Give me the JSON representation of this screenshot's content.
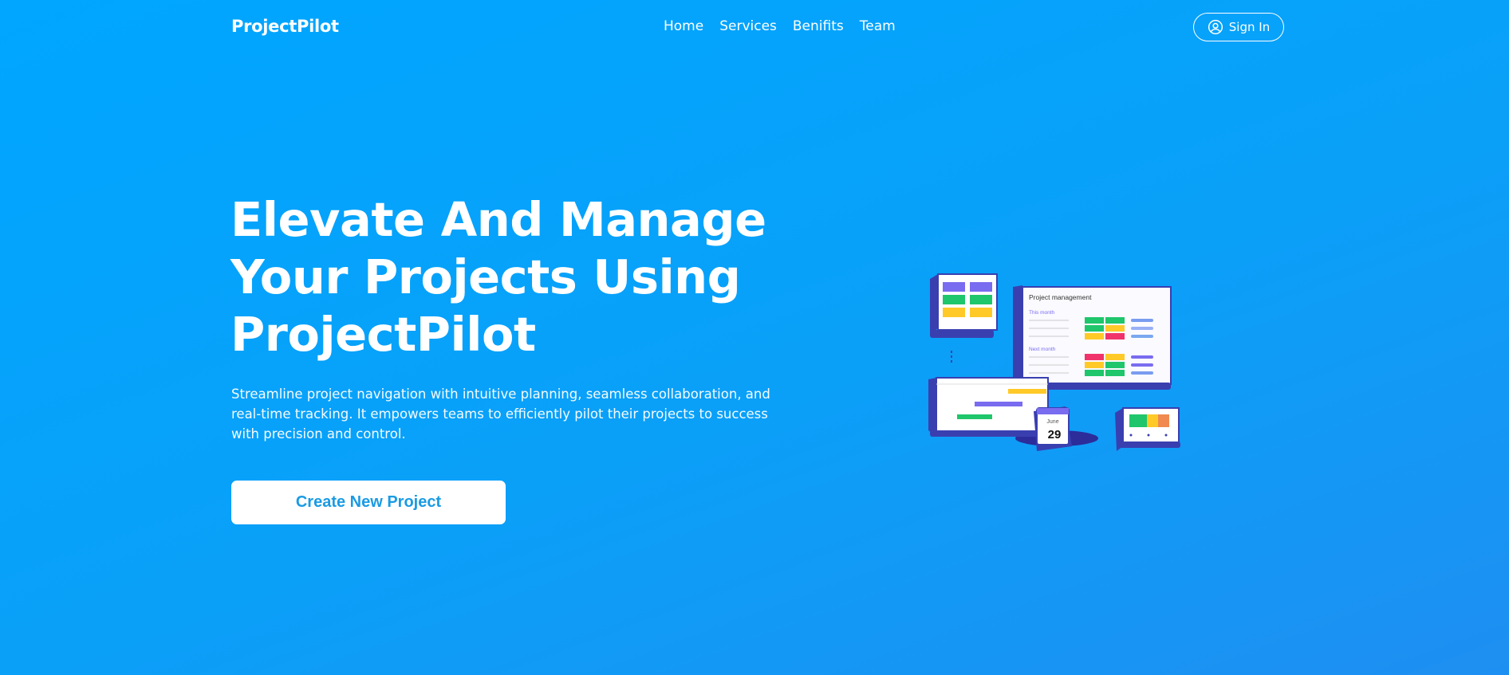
{
  "nav": {
    "logo": "ProjectPilot",
    "links": [
      "Home",
      "Services",
      "Benifits",
      "Team"
    ],
    "signin_label": "Sign In"
  },
  "hero": {
    "title_lines": [
      "Elevate And Manage",
      "Your Projects Using",
      "ProjectPilot"
    ],
    "description": "Streamline project navigation with intuitive planning, seamless collaboration, and real-time tracking. It empowers teams to efficiently pilot their projects to success with precision and control.",
    "cta_label": "Create New Project"
  },
  "illustration": {
    "panel_title": "Project management",
    "section_1": "This month",
    "section_2": "Next month",
    "calendar_month": "June",
    "calendar_day": "29"
  },
  "colors": {
    "background": "#00a6ff",
    "cta_text": "#1a9be3",
    "device_frame": "#3a3fb0",
    "green": "#1fc66b",
    "yellow": "#ffc928",
    "purple": "#7a6cf0",
    "red": "#f0336b"
  }
}
